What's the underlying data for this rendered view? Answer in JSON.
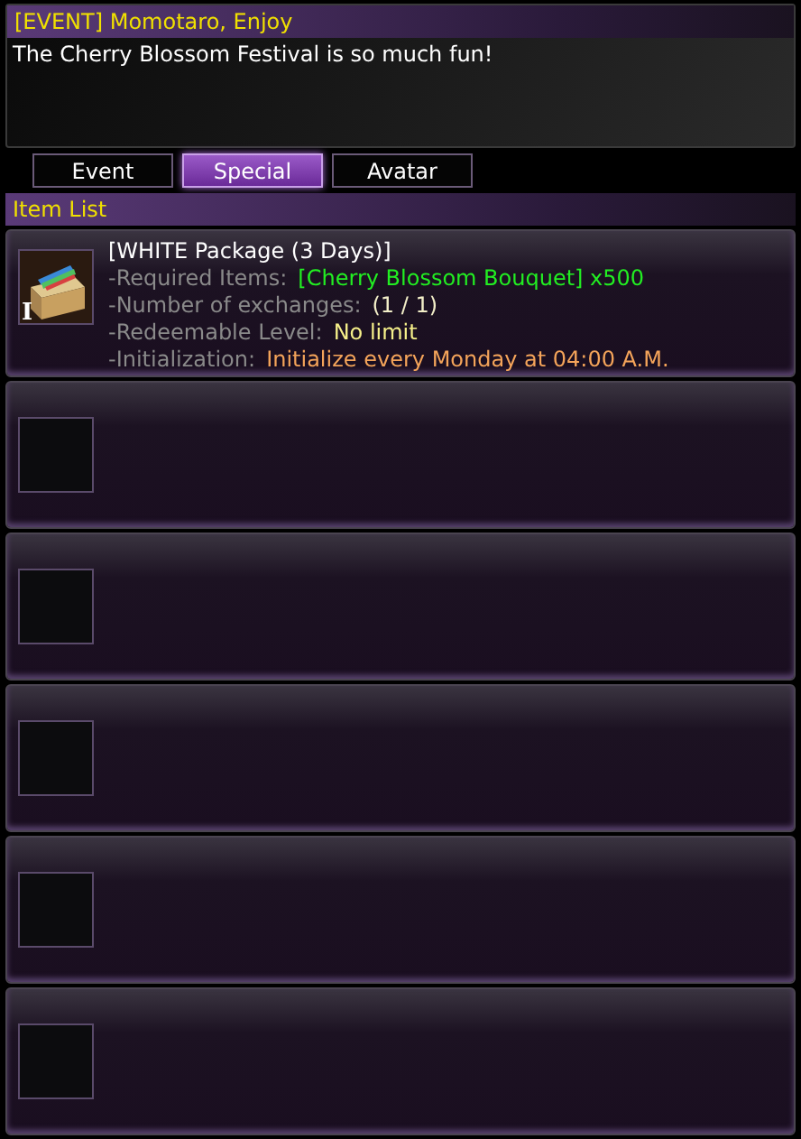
{
  "notice": {
    "title": "[EVENT] Momotaro, Enjoy",
    "message": "The Cherry Blossom Festival is so much fun!"
  },
  "tabs": [
    {
      "label": "Event",
      "selected": false
    },
    {
      "label": "Special",
      "selected": true
    },
    {
      "label": "Avatar",
      "selected": false
    }
  ],
  "item_list": {
    "title": "Item List",
    "items": [
      {
        "kind": "reward",
        "name": "[WHITE Package (3 Days)]",
        "badge": "I",
        "details": [
          {
            "label": "-Required Items:",
            "value": "[Cherry Blossom Bouquet] x500",
            "color": "#22ee22"
          },
          {
            "label": "-Number of exchanges:",
            "value": "(1 / 1)",
            "color": "#f2eec8"
          },
          {
            "label": "-Redeemable Level:",
            "value": "No limit",
            "color": "#f6f08a"
          },
          {
            "label": "-Initialization:",
            "value": "Initialize every Monday at 04:00 A.M.",
            "color": "#f4a45a"
          }
        ]
      },
      {
        "kind": "empty"
      },
      {
        "kind": "empty"
      },
      {
        "kind": "empty"
      },
      {
        "kind": "empty"
      },
      {
        "kind": "empty"
      }
    ]
  }
}
